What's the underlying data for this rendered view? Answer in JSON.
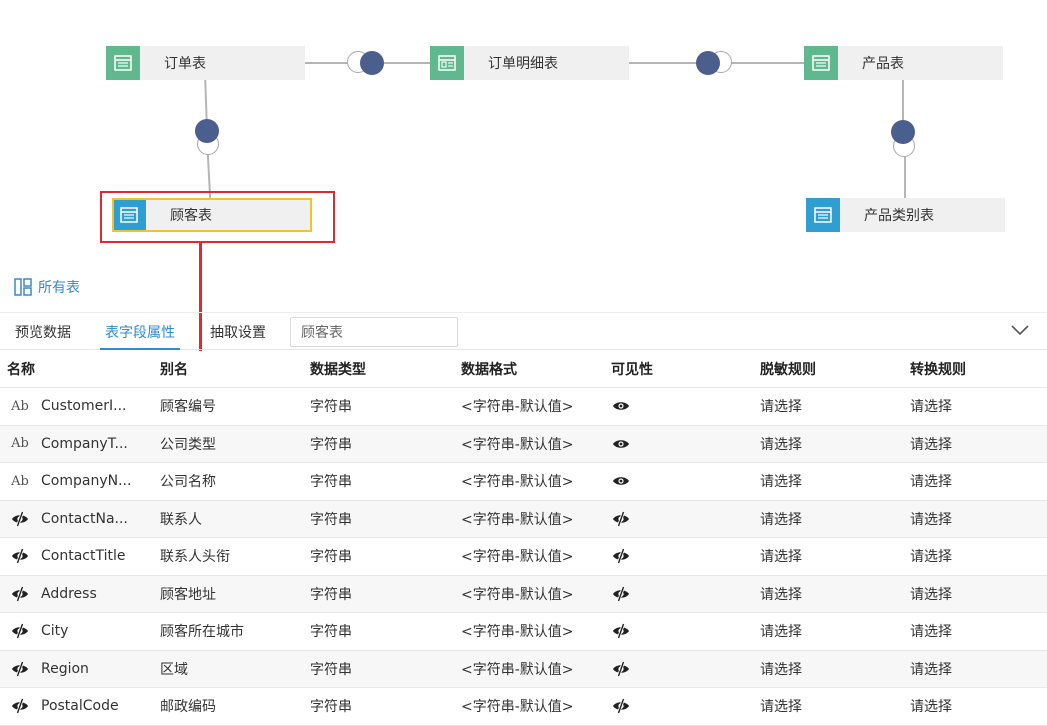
{
  "diagram": {
    "nodes": {
      "orders": {
        "label": "订单表",
        "color": "green"
      },
      "order_details": {
        "label": "订单明细表",
        "color": "green"
      },
      "products": {
        "label": "产品表",
        "color": "green"
      },
      "customers": {
        "label": "顾客表",
        "color": "blue",
        "selected": true
      },
      "categories": {
        "label": "产品类别表",
        "color": "blue"
      }
    },
    "links": [
      {
        "from": "orders",
        "to": "order_details"
      },
      {
        "from": "order_details",
        "to": "products"
      },
      {
        "from": "orders",
        "to": "customers"
      },
      {
        "from": "products",
        "to": "categories"
      }
    ],
    "all_tables_label": "所有表"
  },
  "tabs": {
    "preview": "预览数据",
    "fields": "表字段属性",
    "extract": "抽取设置",
    "active": "fields"
  },
  "table_name_value": "顾客表",
  "grid": {
    "columns": [
      "名称",
      "别名",
      "数据类型",
      "数据格式",
      "可见性",
      "脱敏规则",
      "转换规则"
    ],
    "rows": [
      {
        "type_icon": "text-type-icon",
        "name": "CustomerI...",
        "alias": "顾客编号",
        "dtype": "字符串",
        "format": "<字符串-默认值>",
        "visibility": "visible",
        "mask": "请选择",
        "transform": "请选择"
      },
      {
        "type_icon": "text-type-icon",
        "name": "CompanyT...",
        "alias": "公司类型",
        "dtype": "字符串",
        "format": "<字符串-默认值>",
        "visibility": "visible",
        "mask": "请选择",
        "transform": "请选择"
      },
      {
        "type_icon": "text-type-icon",
        "name": "CompanyN...",
        "alias": "公司名称",
        "dtype": "字符串",
        "format": "<字符串-默认值>",
        "visibility": "visible",
        "mask": "请选择",
        "transform": "请选择"
      },
      {
        "type_icon": "hidden-field-icon",
        "name": "ContactNa...",
        "alias": "联系人",
        "dtype": "字符串",
        "format": "<字符串-默认值>",
        "visibility": "hidden",
        "mask": "请选择",
        "transform": "请选择"
      },
      {
        "type_icon": "hidden-field-icon",
        "name": "ContactTitle",
        "alias": "联系人头衔",
        "dtype": "字符串",
        "format": "<字符串-默认值>",
        "visibility": "hidden",
        "mask": "请选择",
        "transform": "请选择"
      },
      {
        "type_icon": "hidden-field-icon",
        "name": "Address",
        "alias": "顾客地址",
        "dtype": "字符串",
        "format": "<字符串-默认值>",
        "visibility": "hidden",
        "mask": "请选择",
        "transform": "请选择"
      },
      {
        "type_icon": "hidden-field-icon",
        "name": "City",
        "alias": "顾客所在城市",
        "dtype": "字符串",
        "format": "<字符串-默认值>",
        "visibility": "hidden",
        "mask": "请选择",
        "transform": "请选择"
      },
      {
        "type_icon": "hidden-field-icon",
        "name": "Region",
        "alias": "区域",
        "dtype": "字符串",
        "format": "<字符串-默认值>",
        "visibility": "hidden",
        "mask": "请选择",
        "transform": "请选择"
      },
      {
        "type_icon": "hidden-field-icon",
        "name": "PostalCode",
        "alias": "邮政编码",
        "dtype": "字符串",
        "format": "<字符串-默认值>",
        "visibility": "hidden",
        "mask": "请选择",
        "transform": "请选择"
      }
    ]
  },
  "colors": {
    "accent": "#2f8bd6",
    "node_green": "#5fb88e",
    "node_blue": "#2f9fd1",
    "join_fill": "#4a5f8e",
    "highlight_red": "#e02a30",
    "selected_outline": "#f2c230"
  },
  "text_type_glyph": "Ab"
}
